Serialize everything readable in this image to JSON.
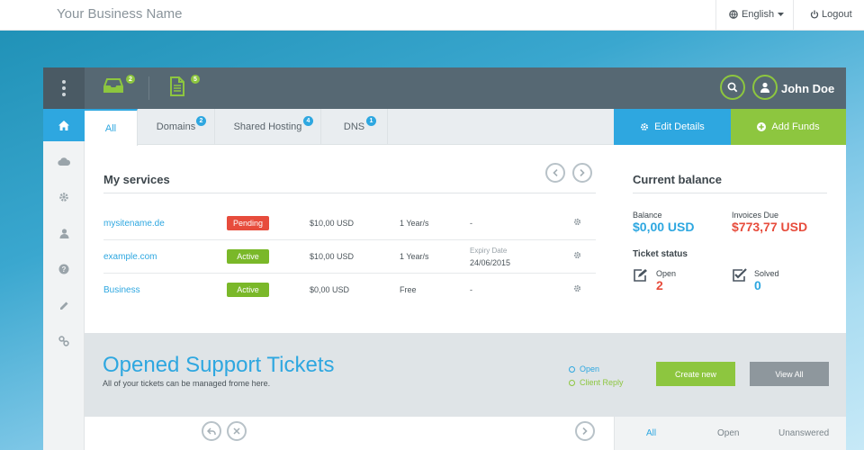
{
  "topbar": {
    "brand": "Your Business Name",
    "language": "English",
    "logout": "Logout"
  },
  "header": {
    "inbox_badge": "2",
    "docs_badge": "5",
    "username": "John Doe"
  },
  "sidebar": {
    "items": [
      "home-icon",
      "cloud-icon",
      "gear-icon",
      "user-icon",
      "help-icon",
      "pencil-icon",
      "link-icon"
    ]
  },
  "tabs": [
    {
      "label": "All",
      "badge": ""
    },
    {
      "label": "Domains",
      "badge": "2"
    },
    {
      "label": "Shared Hosting",
      "badge": "4"
    },
    {
      "label": "DNS",
      "badge": "1"
    }
  ],
  "actions": {
    "edit_details": "Edit Details",
    "add_funds": "Add Funds"
  },
  "services": {
    "title": "My services",
    "rows": [
      {
        "name": "mysitename.de",
        "status": "Pending",
        "status_color": "#e74c3c",
        "price": "$10,00 USD",
        "term": "1 Year/s",
        "expiry": "-",
        "expiry_label": "",
        "expiry_date": ""
      },
      {
        "name": "example.com",
        "status": "Active",
        "status_color": "#7ab829",
        "price": "$10,00 USD",
        "term": "1 Year/s",
        "expiry": "",
        "expiry_label": "Expiry Date",
        "expiry_date": "24/06/2015"
      },
      {
        "name": "Business",
        "status": "Active",
        "status_color": "#7ab829",
        "price": "$0,00 USD",
        "term": "Free",
        "expiry": "-",
        "expiry_label": "",
        "expiry_date": ""
      }
    ]
  },
  "balance": {
    "title": "Current balance",
    "balance_label": "Balance",
    "balance_value": "$0,00 USD",
    "invoices_label": "Invoices Due",
    "invoices_value": "$773,77 USD",
    "ticket_status_title": "Ticket status",
    "open_label": "Open",
    "open_value": "2",
    "solved_label": "Solved",
    "solved_value": "0"
  },
  "tickets": {
    "title": "Opened Support Tickets",
    "subtitle": "All of your tickets can be managed frome here.",
    "legend_open": "Open",
    "legend_client_reply": "Client Reply",
    "create_new": "Create new",
    "view_all": "View All"
  },
  "bottom_tabs": [
    "All",
    "Open",
    "Unanswered"
  ],
  "colors": {
    "accent_blue": "#2ea7e0",
    "accent_green": "#8dc63f",
    "danger_red": "#e74c3c",
    "header_slate": "#566873"
  }
}
